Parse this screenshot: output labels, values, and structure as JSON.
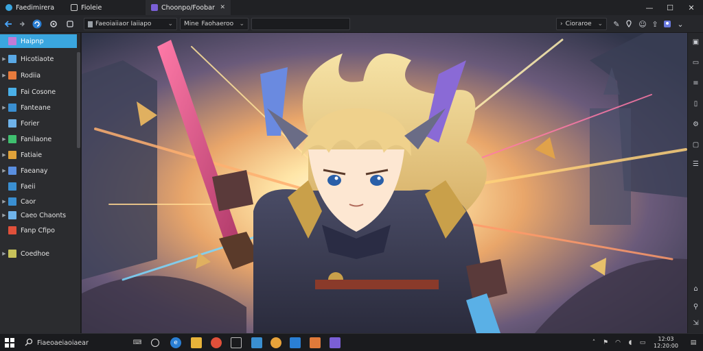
{
  "titlebar": {
    "tabs": [
      {
        "label": "Faedimirera",
        "color": "#3aa6df"
      },
      {
        "label": "Fioleie",
        "color": "#8a8f99"
      },
      {
        "label": "Choonpo/Foobar",
        "color": "#7a5fd6"
      }
    ],
    "active_tab_close": "✕",
    "controls": {
      "minimize": "—",
      "maximize": "☐",
      "close": "✕"
    }
  },
  "toolbar": {
    "address_text": "Faeoiaiiaor Iaiiapo",
    "filter_label": "Mine",
    "filter_value": "Faohaeroo",
    "search_placeholder": "",
    "zoom_label": "Cioraroe"
  },
  "sidebar": {
    "items": [
      {
        "label": "Haipnp",
        "color": "#c37bd6",
        "selected": true,
        "expandable": false
      },
      {
        "label": "Hicotiaote",
        "color": "#5aa9e6",
        "selected": false,
        "expandable": true
      },
      {
        "label": "Rodiia",
        "color": "#e87b3c",
        "selected": false,
        "expandable": true
      },
      {
        "label": "Fai Cosone",
        "color": "#4ab0e8",
        "selected": false,
        "expandable": false
      },
      {
        "label": "Fanteane",
        "color": "#3a8fd1",
        "selected": false,
        "expandable": true
      },
      {
        "label": "Forier",
        "color": "#6fb3ea",
        "selected": false,
        "expandable": false
      },
      {
        "label": "Fanilaone",
        "color": "#3fbf6f",
        "selected": false,
        "expandable": true
      },
      {
        "label": "Fatiaie",
        "color": "#e0a23a",
        "selected": false,
        "expandable": true
      },
      {
        "label": "Faeanay",
        "color": "#5a8fe0",
        "selected": false,
        "expandable": true
      },
      {
        "label": "Faeii",
        "color": "#3a8fd1",
        "selected": false,
        "expandable": false
      },
      {
        "label": "Caor",
        "color": "#3a8fd1",
        "selected": false,
        "expandable": true
      },
      {
        "label": "Caeo Chaonts",
        "color": "#6fb3ea",
        "selected": false,
        "expandable": true
      },
      {
        "label": "Fanp Cfipo",
        "color": "#e0503a",
        "selected": false,
        "expandable": false
      },
      {
        "label": "Coedhoe",
        "color": "#c7c25a",
        "selected": false,
        "expandable": true
      }
    ]
  },
  "taskbar": {
    "search_text": "Fiaeoaeiaoiaear",
    "clock_time": "12:03",
    "clock_date": "12:20:00"
  },
  "icons": {
    "back": "arrow-left-icon",
    "forward": "arrow-right-icon",
    "windows": "windows-start-icon"
  }
}
